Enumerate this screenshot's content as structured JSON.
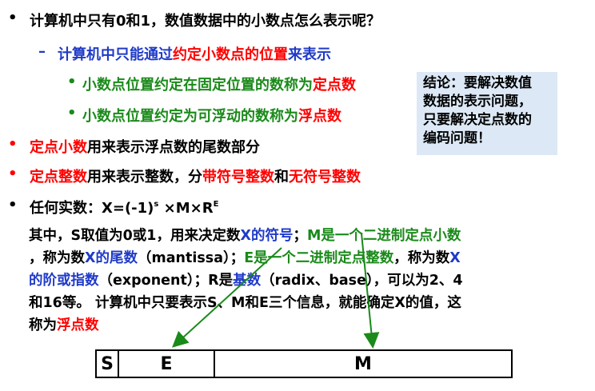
{
  "bullets": {
    "b1": "计算机中只有0和1，数值数据中的小数点怎么表示呢？",
    "b2_prefix": "计算机中只能通过",
    "b2_red": "约定小数点的位置",
    "b2_suffix": "来表示",
    "b3_prefix": "小数点位置约定在固定位置的数称为",
    "b3_red": "定点数",
    "b4_prefix": "小数点位置约定为可浮动的数称为",
    "b4_red": "浮点数",
    "b5_red": "定点小数",
    "b5_suffix": "用来表示浮点数的尾数部分",
    "b6_red": "定点整数",
    "b6_mid": "用来表示整数，分",
    "b6_red2": "带符号整数",
    "b6_and": "和",
    "b6_red3": "无符号整数",
    "b7_prefix": "任何实数：X=(-1)",
    "b7_sup1": "s",
    "b7_mid": " ×M×R",
    "b7_sup2": "E"
  },
  "paragraph": {
    "p1_a": "其中，S取值为0或1，用来决定数",
    "p1_b": "X的符号",
    "p1_c": "；",
    "p1_d": "M是一个二进制定点小数",
    "p2_a": "，称为数",
    "p2_b": "X的尾数",
    "p2_c": "（mantissa）；",
    "p2_d": "E是一个二进制定点整数",
    "p2_e": "，称为数",
    "p2_f": "X",
    "p3_a": "的阶或指数",
    "p3_b": "（exponent）；R是",
    "p3_c": "基数",
    "p3_d": "（radix、base），可以为2、4",
    "p4": "和16等。 计算机中只要表示S、M和E三个信息，就能确定X的值，这",
    "p5_a": "称为",
    "p5_b": "浮点数"
  },
  "callout": {
    "line1": "结论：要解决数值",
    "line2": "数据的表示问题，",
    "line3": "只要解决定点数的",
    "line4": "编码问题！"
  },
  "format": {
    "s": "S",
    "e": "E",
    "m": "M"
  },
  "colors": {
    "blue": "#1f3ac8",
    "red": "#ff0000",
    "green": "#1a8a1a",
    "callout_bg": "#dce8f5"
  }
}
